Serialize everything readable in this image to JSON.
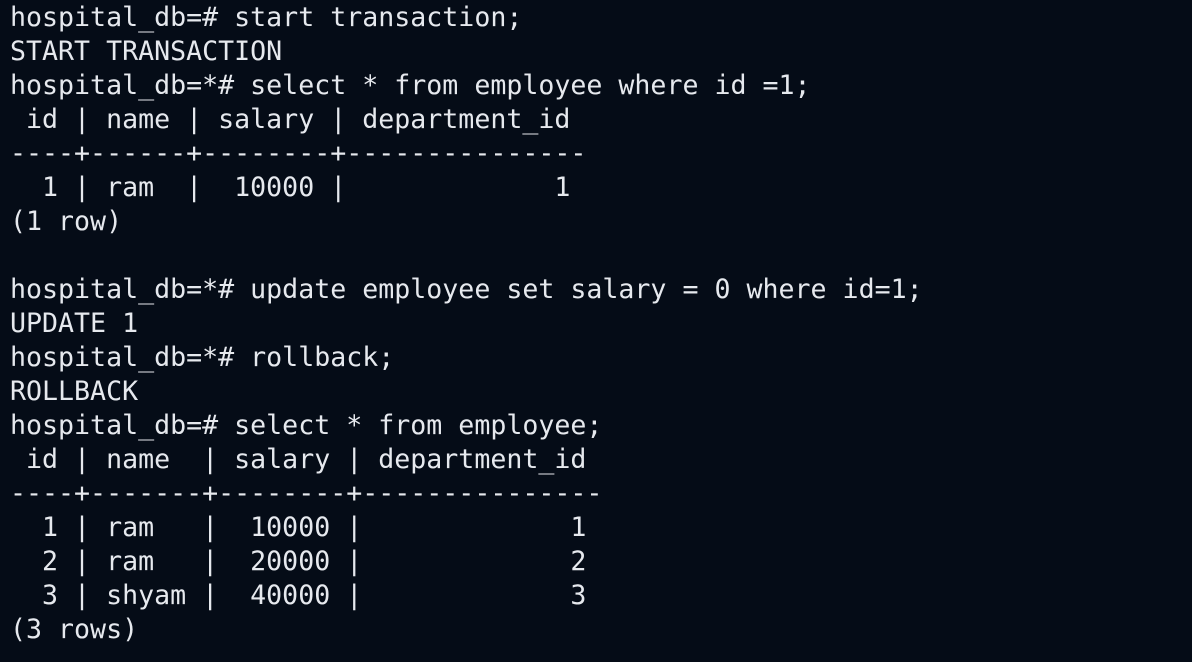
{
  "terminal": {
    "lines": [
      "hospital_db=# start transaction;",
      "START TRANSACTION",
      "hospital_db=*# select * from employee where id =1;",
      " id | name | salary | department_id",
      "----+------+--------+---------------",
      "  1 | ram  |  10000 |             1",
      "(1 row)",
      "",
      "hospital_db=*# update employee set salary = 0 where id=1;",
      "UPDATE 1",
      "hospital_db=*# rollback;",
      "ROLLBACK",
      "hospital_db=# select * from employee;",
      " id | name  | salary | department_id",
      "----+-------+--------+---------------",
      "  1 | ram   |  10000 |             1",
      "  2 | ram   |  20000 |             2",
      "  3 | shyam |  40000 |             3",
      "(3 rows)"
    ]
  },
  "colors": {
    "background": "#050c17",
    "text": "#e6e9ee"
  }
}
